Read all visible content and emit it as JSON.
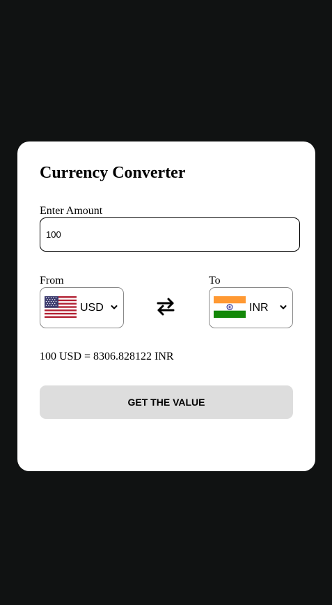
{
  "converter": {
    "title": "Currency Converter",
    "amount_label": "Enter Amount",
    "amount_value": "100",
    "from_label": "From",
    "to_label": "To",
    "from_currency": "USD",
    "to_currency": "INR",
    "from_flag_icon": "us-flag-icon",
    "to_flag_icon": "india-flag-icon",
    "swap_icon": "swap-arrows-icon",
    "result_text": "100 USD = 8306.828122 INR",
    "button_label": "GET THE VALUE"
  },
  "colors": {
    "page_background": "#101212",
    "card_background": "#ffffff",
    "button_background": "#dddddd",
    "india_saffron": "#ff9933",
    "india_green": "#138808",
    "us_red": "#b22234",
    "us_blue": "#3c3b6e"
  }
}
